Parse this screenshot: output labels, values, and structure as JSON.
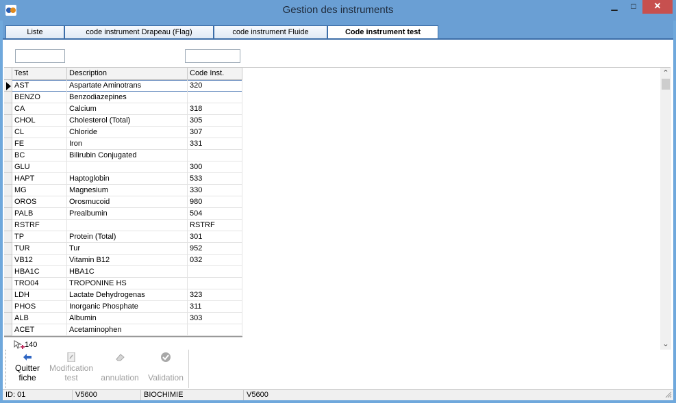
{
  "window": {
    "title": "Gestion des instruments",
    "min_glyph": "▁",
    "max_glyph": "□",
    "close_glyph": "✕"
  },
  "tabs": [
    {
      "label": "Liste"
    },
    {
      "label": "code instrument Drapeau (Flag)"
    },
    {
      "label": "code instrument Fluide"
    },
    {
      "label": "Code instrument test",
      "active": true
    }
  ],
  "filters": {
    "filter1": "",
    "filter2": ""
  },
  "grid": {
    "columns": [
      "Test",
      "Description",
      "Code Inst."
    ],
    "rows": [
      {
        "test": "AST",
        "description": "Aspartate Aminotrans",
        "code": "320"
      },
      {
        "test": "BENZO",
        "description": "Benzodiazepines",
        "code": ""
      },
      {
        "test": "CA",
        "description": "Calcium",
        "code": "318"
      },
      {
        "test": "CHOL",
        "description": "Cholesterol (Total)",
        "code": "305"
      },
      {
        "test": "CL",
        "description": "Chloride",
        "code": "307"
      },
      {
        "test": "FE",
        "description": "Iron",
        "code": "331"
      },
      {
        "test": "BC",
        "description": "Bilirubin Conjugated",
        "code": ""
      },
      {
        "test": "GLU",
        "description": "",
        "code": "300"
      },
      {
        "test": "HAPT",
        "description": "Haptoglobin",
        "code": "533"
      },
      {
        "test": "MG",
        "description": "Magnesium",
        "code": "330"
      },
      {
        "test": "OROS",
        "description": "Orosmucoid",
        "code": "980"
      },
      {
        "test": "PALB",
        "description": "Prealbumin",
        "code": "504"
      },
      {
        "test": "RSTRF",
        "description": "",
        "code": "RSTRF"
      },
      {
        "test": "TP",
        "description": "Protein (Total)",
        "code": "301"
      },
      {
        "test": "TUR",
        "description": "Tur",
        "code": "952"
      },
      {
        "test": "VB12",
        "description": "Vitamin B12",
        "code": "032"
      },
      {
        "test": "HBA1C",
        "description": "HBA1C",
        "code": ""
      },
      {
        "test": "TRO04",
        "description": "TROPONINE HS",
        "code": ""
      },
      {
        "test": "LDH",
        "description": "Lactate Dehydrogenas",
        "code": "323"
      },
      {
        "test": "PHOS",
        "description": "Inorganic Phosphate",
        "code": "311"
      },
      {
        "test": "ALB",
        "description": "Albumin",
        "code": "303"
      },
      {
        "test": "ACET",
        "description": "Acetaminophen",
        "code": ""
      }
    ],
    "selected_row": 0,
    "record_count": "140"
  },
  "toolbar": {
    "quit": {
      "line1": "Quitter",
      "line2": "fiche",
      "icon": "back-arrow-icon"
    },
    "modify": {
      "line1": "Modification",
      "line2": "test",
      "icon": "edit-document-icon"
    },
    "cancel": {
      "line1": "annulation",
      "icon": "eraser-icon"
    },
    "validate": {
      "line1": "Validation",
      "icon": "check-circle-icon"
    }
  },
  "status": {
    "id": "ID: 01",
    "instrument": "V5600",
    "department": "BIOCHIMIE",
    "instrument2": "V5600"
  },
  "colors": {
    "titlebar": "#6a9fd4",
    "close": "#c7504f",
    "tab_border": "#3c6ea8"
  }
}
